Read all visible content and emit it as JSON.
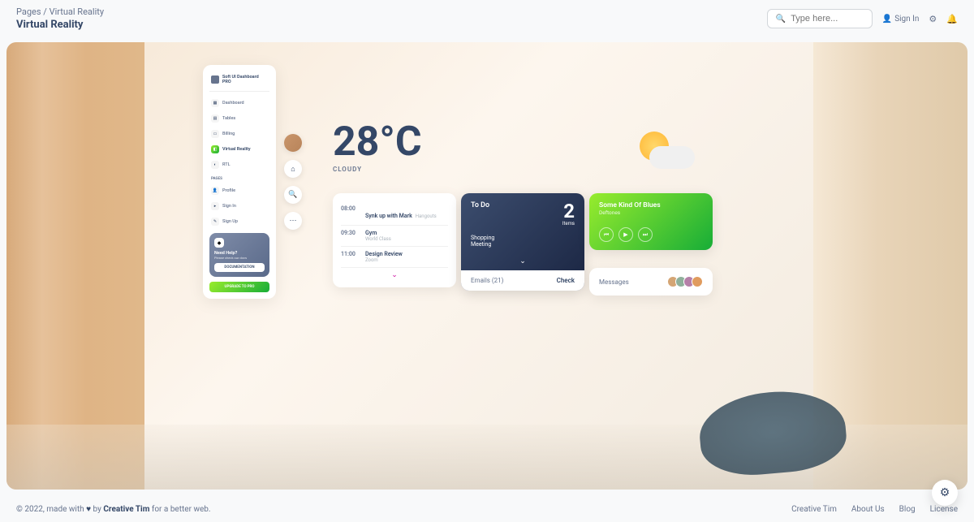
{
  "breadcrumb": {
    "root": "Pages",
    "current": "Virtual Reality"
  },
  "page_title": "Virtual Reality",
  "search": {
    "placeholder": "Type here..."
  },
  "header": {
    "signin": "Sign In"
  },
  "sidebar": {
    "brand": "Soft UI Dashboard PRO",
    "items": [
      {
        "label": "Dashboard",
        "icon": "▦"
      },
      {
        "label": "Tables",
        "icon": "▤"
      },
      {
        "label": "Billing",
        "icon": "▭"
      },
      {
        "label": "Virtual Reality",
        "icon": "◧"
      },
      {
        "label": "RTL",
        "icon": "◐"
      }
    ],
    "section": "PAGES",
    "pages": [
      {
        "label": "Profile",
        "icon": "👤"
      },
      {
        "label": "Sign In",
        "icon": "▸"
      },
      {
        "label": "Sign Up",
        "icon": "✎"
      }
    ],
    "help": {
      "title": "Need Help?",
      "sub": "Please check our docs",
      "doc_btn": "DOCUMENTATION"
    },
    "upgrade": "UPGRADE TO PRO"
  },
  "weather": {
    "temperature": "28°C",
    "condition": "CLOUDY"
  },
  "schedule": [
    {
      "time": "08:00",
      "title": "Synk up with Mark",
      "sub": "Hangouts"
    },
    {
      "time": "09:30",
      "title": "Gym",
      "sub": "World Class"
    },
    {
      "time": "11:00",
      "title": "Design Review",
      "sub": "Zoom"
    }
  ],
  "todo": {
    "title": "To Do",
    "count": "2",
    "items_label": "Items",
    "tasks": [
      "Shopping",
      "Meeting"
    ]
  },
  "emails": {
    "label": "Emails (21)",
    "action": "Check"
  },
  "music": {
    "title": "Some Kind Of Blues",
    "artist": "Deftones"
  },
  "messages": {
    "label": "Messages"
  },
  "footer": {
    "year": "© 2022,",
    "made": "made with",
    "by": "by",
    "author": "Creative Tim",
    "tail": "for a better web.",
    "links": [
      "Creative Tim",
      "About Us",
      "Blog",
      "License"
    ]
  }
}
